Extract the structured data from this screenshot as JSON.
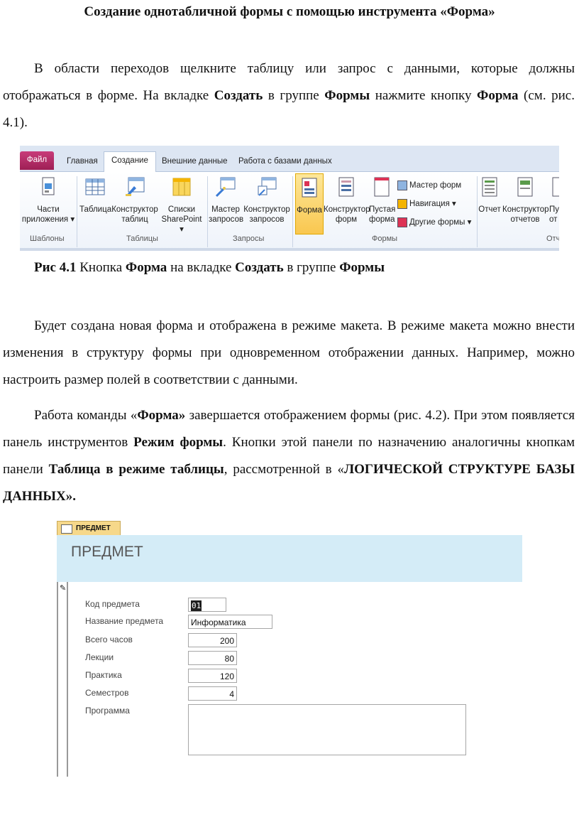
{
  "document": {
    "title": "Создание однотабличной формы с помощью инструмента «Форма»",
    "para1": {
      "t1": "В области переходов щелкните таблицу или запрос с данными, которые должны отображаться в форме. На вкладке ",
      "b1": "Создать",
      "t2": " в группе ",
      "b2": "Формы",
      "t3": " нажмите кнопку ",
      "b3": "Форма",
      "t4": "  (см. рис. 4.1)."
    },
    "caption": {
      "b1": "Рис 4.1",
      "t1": "  Кнопка ",
      "b2": "Форма",
      "t2": " на вкладке ",
      "b3": "Создать",
      "t3": " в группе ",
      "b4": "Формы"
    },
    "para2": "Будет создана новая форма и отображена в режиме макета. В режиме макета можно внести изменения в структуру формы при одновременном отображении данных. Например, можно настроить размер полей в соответствии с данными.",
    "para3": {
      "t1": "Работа команды «",
      "b1": "Форма»",
      "t2": " завершается отображением формы (рис. 4.2). При этом появляется панель инструментов ",
      "b2": "Режим формы",
      "t3": ". Кнопки этой панели по назначению аналогичны кнопкам панели ",
      "b3": "Таблица в режиме таблицы",
      "t4": ", рассмотренной в «",
      "b4": "ЛОГИЧЕСКОЙ СТРУКТУРЕ БАЗЫ ДАННЫХ»."
    }
  },
  "ribbon": {
    "tabs": [
      "Файл",
      "Главная",
      "Создание",
      "Внешние данные",
      "Работа с базами данных"
    ],
    "groups": [
      "Шаблоны",
      "Таблицы",
      "Запросы",
      "Формы",
      "Отч"
    ],
    "buttons": {
      "parts1": "Части",
      "parts2": "приложения ▾",
      "table": "Таблица",
      "tconstr1": "Конструктор",
      "tconstr2": "таблиц",
      "lists1": "Списки",
      "lists2": "SharePoint ▾",
      "qwiz1": "Мастер",
      "qwiz2": "запросов",
      "qcon1": "Конструктор",
      "qcon2": "запросов",
      "form": "Форма",
      "fcon1": "Конструктор",
      "fcon2": "форм",
      "blank1": "Пустая",
      "blank2": "форма",
      "fwiz": "Мастер форм",
      "nav": "Навигация ▾",
      "other": "Другие формы ▾",
      "report": "Отчет",
      "rcon1": "Конструктор",
      "rcon2": "отчетов",
      "rcut1": "Пу",
      "rcut2": "от"
    },
    "colors": {
      "file_tab": "#b8306a",
      "highlight": "#f9c74f"
    }
  },
  "form": {
    "tab_label": "ПРЕДМЕТ",
    "header_title": "ПРЕДМЕТ",
    "fields": [
      {
        "label": "Код предмета",
        "value": "01"
      },
      {
        "label": "Название предмета",
        "value": "Информатика"
      },
      {
        "label": "Всего часов",
        "value": "200"
      },
      {
        "label": "Лекции",
        "value": "80"
      },
      {
        "label": "Практика",
        "value": "120"
      },
      {
        "label": "Семестров",
        "value": "4"
      },
      {
        "label": "Программа",
        "value": ""
      }
    ],
    "colors": {
      "header_bg": "#d4ecf7",
      "tab_bg": "#f6d88a"
    }
  }
}
